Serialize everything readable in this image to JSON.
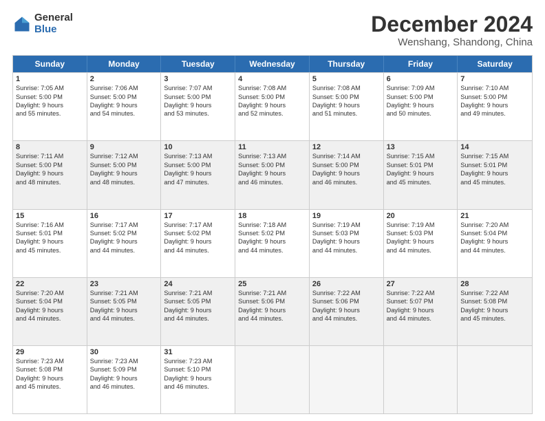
{
  "logo": {
    "general": "General",
    "blue": "Blue"
  },
  "title": "December 2024",
  "location": "Wenshang, Shandong, China",
  "days": [
    "Sunday",
    "Monday",
    "Tuesday",
    "Wednesday",
    "Thursday",
    "Friday",
    "Saturday"
  ],
  "weeks": [
    [
      {
        "num": "1",
        "lines": [
          "Sunrise: 7:05 AM",
          "Sunset: 5:00 PM",
          "Daylight: 9 hours",
          "and 55 minutes."
        ]
      },
      {
        "num": "2",
        "lines": [
          "Sunrise: 7:06 AM",
          "Sunset: 5:00 PM",
          "Daylight: 9 hours",
          "and 54 minutes."
        ]
      },
      {
        "num": "3",
        "lines": [
          "Sunrise: 7:07 AM",
          "Sunset: 5:00 PM",
          "Daylight: 9 hours",
          "and 53 minutes."
        ]
      },
      {
        "num": "4",
        "lines": [
          "Sunrise: 7:08 AM",
          "Sunset: 5:00 PM",
          "Daylight: 9 hours",
          "and 52 minutes."
        ]
      },
      {
        "num": "5",
        "lines": [
          "Sunrise: 7:08 AM",
          "Sunset: 5:00 PM",
          "Daylight: 9 hours",
          "and 51 minutes."
        ]
      },
      {
        "num": "6",
        "lines": [
          "Sunrise: 7:09 AM",
          "Sunset: 5:00 PM",
          "Daylight: 9 hours",
          "and 50 minutes."
        ]
      },
      {
        "num": "7",
        "lines": [
          "Sunrise: 7:10 AM",
          "Sunset: 5:00 PM",
          "Daylight: 9 hours",
          "and 49 minutes."
        ]
      }
    ],
    [
      {
        "num": "8",
        "lines": [
          "Sunrise: 7:11 AM",
          "Sunset: 5:00 PM",
          "Daylight: 9 hours",
          "and 48 minutes."
        ]
      },
      {
        "num": "9",
        "lines": [
          "Sunrise: 7:12 AM",
          "Sunset: 5:00 PM",
          "Daylight: 9 hours",
          "and 48 minutes."
        ]
      },
      {
        "num": "10",
        "lines": [
          "Sunrise: 7:13 AM",
          "Sunset: 5:00 PM",
          "Daylight: 9 hours",
          "and 47 minutes."
        ]
      },
      {
        "num": "11",
        "lines": [
          "Sunrise: 7:13 AM",
          "Sunset: 5:00 PM",
          "Daylight: 9 hours",
          "and 46 minutes."
        ]
      },
      {
        "num": "12",
        "lines": [
          "Sunrise: 7:14 AM",
          "Sunset: 5:00 PM",
          "Daylight: 9 hours",
          "and 46 minutes."
        ]
      },
      {
        "num": "13",
        "lines": [
          "Sunrise: 7:15 AM",
          "Sunset: 5:01 PM",
          "Daylight: 9 hours",
          "and 45 minutes."
        ]
      },
      {
        "num": "14",
        "lines": [
          "Sunrise: 7:15 AM",
          "Sunset: 5:01 PM",
          "Daylight: 9 hours",
          "and 45 minutes."
        ]
      }
    ],
    [
      {
        "num": "15",
        "lines": [
          "Sunrise: 7:16 AM",
          "Sunset: 5:01 PM",
          "Daylight: 9 hours",
          "and 45 minutes."
        ]
      },
      {
        "num": "16",
        "lines": [
          "Sunrise: 7:17 AM",
          "Sunset: 5:02 PM",
          "Daylight: 9 hours",
          "and 44 minutes."
        ]
      },
      {
        "num": "17",
        "lines": [
          "Sunrise: 7:17 AM",
          "Sunset: 5:02 PM",
          "Daylight: 9 hours",
          "and 44 minutes."
        ]
      },
      {
        "num": "18",
        "lines": [
          "Sunrise: 7:18 AM",
          "Sunset: 5:02 PM",
          "Daylight: 9 hours",
          "and 44 minutes."
        ]
      },
      {
        "num": "19",
        "lines": [
          "Sunrise: 7:19 AM",
          "Sunset: 5:03 PM",
          "Daylight: 9 hours",
          "and 44 minutes."
        ]
      },
      {
        "num": "20",
        "lines": [
          "Sunrise: 7:19 AM",
          "Sunset: 5:03 PM",
          "Daylight: 9 hours",
          "and 44 minutes."
        ]
      },
      {
        "num": "21",
        "lines": [
          "Sunrise: 7:20 AM",
          "Sunset: 5:04 PM",
          "Daylight: 9 hours",
          "and 44 minutes."
        ]
      }
    ],
    [
      {
        "num": "22",
        "lines": [
          "Sunrise: 7:20 AM",
          "Sunset: 5:04 PM",
          "Daylight: 9 hours",
          "and 44 minutes."
        ]
      },
      {
        "num": "23",
        "lines": [
          "Sunrise: 7:21 AM",
          "Sunset: 5:05 PM",
          "Daylight: 9 hours",
          "and 44 minutes."
        ]
      },
      {
        "num": "24",
        "lines": [
          "Sunrise: 7:21 AM",
          "Sunset: 5:05 PM",
          "Daylight: 9 hours",
          "and 44 minutes."
        ]
      },
      {
        "num": "25",
        "lines": [
          "Sunrise: 7:21 AM",
          "Sunset: 5:06 PM",
          "Daylight: 9 hours",
          "and 44 minutes."
        ]
      },
      {
        "num": "26",
        "lines": [
          "Sunrise: 7:22 AM",
          "Sunset: 5:06 PM",
          "Daylight: 9 hours",
          "and 44 minutes."
        ]
      },
      {
        "num": "27",
        "lines": [
          "Sunrise: 7:22 AM",
          "Sunset: 5:07 PM",
          "Daylight: 9 hours",
          "and 44 minutes."
        ]
      },
      {
        "num": "28",
        "lines": [
          "Sunrise: 7:22 AM",
          "Sunset: 5:08 PM",
          "Daylight: 9 hours",
          "and 45 minutes."
        ]
      }
    ],
    [
      {
        "num": "29",
        "lines": [
          "Sunrise: 7:23 AM",
          "Sunset: 5:08 PM",
          "Daylight: 9 hours",
          "and 45 minutes."
        ]
      },
      {
        "num": "30",
        "lines": [
          "Sunrise: 7:23 AM",
          "Sunset: 5:09 PM",
          "Daylight: 9 hours",
          "and 46 minutes."
        ]
      },
      {
        "num": "31",
        "lines": [
          "Sunrise: 7:23 AM",
          "Sunset: 5:10 PM",
          "Daylight: 9 hours",
          "and 46 minutes."
        ]
      },
      null,
      null,
      null,
      null
    ]
  ]
}
